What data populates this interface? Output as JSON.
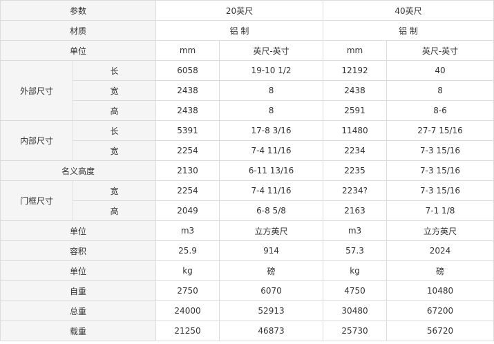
{
  "header": {
    "param": "参数",
    "col20": "20英尺",
    "col40": "40英尺"
  },
  "material": {
    "label": "材质",
    "v20": "铝 制",
    "v40": "铝 制"
  },
  "unit_row1": {
    "label": "单位",
    "a": "mm",
    "b": "英尺-英寸",
    "c": "mm",
    "d": "英尺-英寸"
  },
  "outer": {
    "group": "外部尺寸",
    "rows": [
      {
        "sub": "长",
        "a": "6058",
        "b": "19-10 1/2",
        "c": "12192",
        "d": "40"
      },
      {
        "sub": "宽",
        "a": "2438",
        "b": "8",
        "c": "2438",
        "d": "8"
      },
      {
        "sub": "高",
        "a": "2438",
        "b": "8",
        "c": "2591",
        "d": "8-6"
      }
    ]
  },
  "inner": {
    "group": "内部尺寸",
    "rows": [
      {
        "sub": "长",
        "a": "5391",
        "b": "17-8 3/16",
        "c": "11480",
        "d": "27-7 15/16"
      },
      {
        "sub": "宽",
        "a": "2254",
        "b": "7-4 11/16",
        "c": "2234",
        "d": "7-3 15/16"
      }
    ]
  },
  "nominal": {
    "label": "名义高度",
    "a": "2130",
    "b": "6-11 13/16",
    "c": "2235",
    "d": "7-3 15/16"
  },
  "door": {
    "group": "门框尺寸",
    "rows": [
      {
        "sub": "宽",
        "a": "2254",
        "b": "7-4 11/16",
        "c": "2234?",
        "d": "7-3 15/16"
      },
      {
        "sub": "高",
        "a": "2049",
        "b": "6-8 5/8",
        "c": "2163",
        "d": "7-1 1/8"
      }
    ]
  },
  "unit_row2": {
    "label": "单位",
    "a": "m3",
    "b": "立方英尺",
    "c": "m3",
    "d": "立方英尺"
  },
  "capacity": {
    "label": "容积",
    "a": "25.9",
    "b": "914",
    "c": "57.3",
    "d": "2024"
  },
  "unit_row3": {
    "label": "单位",
    "a": "kg",
    "b": "磅",
    "c": "kg",
    "d": "磅"
  },
  "tare": {
    "label": "自重",
    "a": "2750",
    "b": "6070",
    "c": "4750",
    "d": "10480"
  },
  "gross": {
    "label": "总重",
    "a": "24000",
    "b": "52913",
    "c": "30480",
    "d": "67200"
  },
  "payload": {
    "label": "载重",
    "a": "21250",
    "b": "46873",
    "c": "25730",
    "d": "56720"
  }
}
